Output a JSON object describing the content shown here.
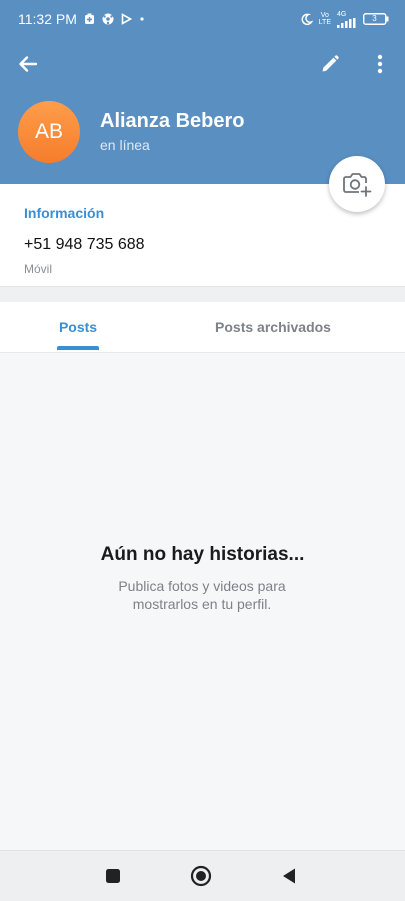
{
  "status_bar": {
    "time": "11:32 PM",
    "network_top": "Vo",
    "network_bottom": "LTE",
    "signal_label": "4G",
    "battery": "3"
  },
  "header": {
    "avatar_initials": "AB",
    "name": "Alianza Bebero",
    "status": "en línea",
    "icons": [
      "arrow-back-icon",
      "pencil-icon",
      "more-vertical-icon",
      "camera-plus-icon"
    ]
  },
  "info": {
    "title": "Información",
    "phone": "+51 948 735 688",
    "phone_label": "Móvil"
  },
  "tabs": [
    {
      "label": "Posts",
      "active": true
    },
    {
      "label": "Posts archivados",
      "active": false
    }
  ],
  "empty_state": {
    "title": "Aún no hay historias...",
    "subtitle": "Publica fotos y videos para mostrarlos en tu perfil."
  },
  "colors": {
    "header": "#5a8fc2",
    "accent": "#3a8fd3",
    "avatar": "#f57d2c"
  }
}
